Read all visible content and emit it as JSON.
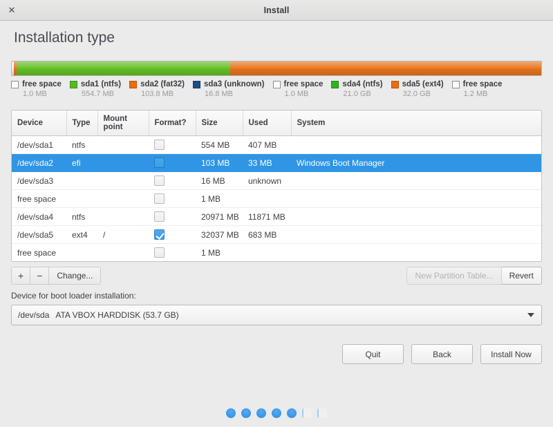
{
  "window": {
    "title": "Install",
    "close_icon": "close-icon"
  },
  "page": {
    "title": "Installation type"
  },
  "partition_bar": {
    "segments": [
      {
        "label": "free space",
        "size": "1.0 MB",
        "color": "#f1f1f1",
        "width_pct": 0.35
      },
      {
        "label": "sda1 (ntfs)",
        "size": "554.7 MB",
        "color": "#e8741c",
        "width_pct": 0.6
      },
      {
        "label": "sda1-body",
        "size": "",
        "color": "#64c023",
        "width_pct": 40.3
      },
      {
        "label": "sda2 (fat32)",
        "size": "103.8 MB",
        "color": "#e8741c",
        "width_pct": 58.75
      }
    ]
  },
  "legend": [
    {
      "label": "free space",
      "size": "1.0 MB",
      "swatch": "#fdfdfd",
      "border": "#8d8d8d"
    },
    {
      "label": "sda1 (ntfs)",
      "size": "554.7 MB",
      "swatch": "#56bb22",
      "border": "#3e8f16"
    },
    {
      "label": "sda2 (fat32)",
      "size": "103.8 MB",
      "swatch": "#ec6d0e",
      "border": "#b85309"
    },
    {
      "label": "sda3 (unknown)",
      "size": "16.8 MB",
      "swatch": "#1b4e86",
      "border": "#133a66"
    },
    {
      "label": "free space",
      "size": "1.0 MB",
      "swatch": "#fdfdfd",
      "border": "#8d8d8d"
    },
    {
      "label": "sda4 (ntfs)",
      "size": "21.0 GB",
      "swatch": "#2fb320",
      "border": "#248816"
    },
    {
      "label": "sda5 (ext4)",
      "size": "32.0 GB",
      "swatch": "#ec6d0e",
      "border": "#b85309"
    },
    {
      "label": "free space",
      "size": "1.2 MB",
      "swatch": "#fdfdfd",
      "border": "#8d8d8d"
    }
  ],
  "table": {
    "columns": [
      "Device",
      "Type",
      "Mount point",
      "Format?",
      "Size",
      "Used",
      "System"
    ],
    "rows": [
      {
        "device": "/dev/sda1",
        "type": "ntfs",
        "mount": "",
        "format": false,
        "size": "554 MB",
        "used": "407 MB",
        "system": "",
        "selected": false
      },
      {
        "device": "/dev/sda2",
        "type": "efi",
        "mount": "",
        "format": false,
        "size": "103 MB",
        "used": "33 MB",
        "system": "Windows Boot Manager",
        "selected": true
      },
      {
        "device": "/dev/sda3",
        "type": "",
        "mount": "",
        "format": false,
        "size": "16 MB",
        "used": "unknown",
        "system": "",
        "selected": false
      },
      {
        "device": "free space",
        "type": "",
        "mount": "",
        "format": false,
        "size": "1 MB",
        "used": "",
        "system": "",
        "selected": false
      },
      {
        "device": "/dev/sda4",
        "type": "ntfs",
        "mount": "",
        "format": false,
        "size": "20971 MB",
        "used": "11871 MB",
        "system": "",
        "selected": false
      },
      {
        "device": "/dev/sda5",
        "type": "ext4",
        "mount": "/",
        "format": true,
        "size": "32037 MB",
        "used": "683 MB",
        "system": "",
        "selected": false
      },
      {
        "device": "free space",
        "type": "",
        "mount": "",
        "format": false,
        "size": "1 MB",
        "used": "",
        "system": "",
        "selected": false
      }
    ]
  },
  "toolbar": {
    "add_label": "+",
    "remove_label": "−",
    "change_label": "Change...",
    "new_partition_table_label": "New Partition Table...",
    "new_partition_table_disabled": true,
    "revert_label": "Revert"
  },
  "bootloader": {
    "label": "Device for boot loader installation:",
    "selected_device": "/dev/sda",
    "selected_description": "ATA VBOX HARDDISK (53.7 GB)",
    "dropdown_icon": "chevron-down-icon"
  },
  "actions": {
    "quit_label": "Quit",
    "back_label": "Back",
    "install_label": "Install Now"
  },
  "progress_dots": {
    "total": 7,
    "filled": 5
  },
  "colors": {
    "accent": "#2f95e4",
    "green": "#56bb22",
    "orange": "#ec6d0e",
    "navy": "#1b4e86",
    "window_bg": "#ebebeb"
  }
}
